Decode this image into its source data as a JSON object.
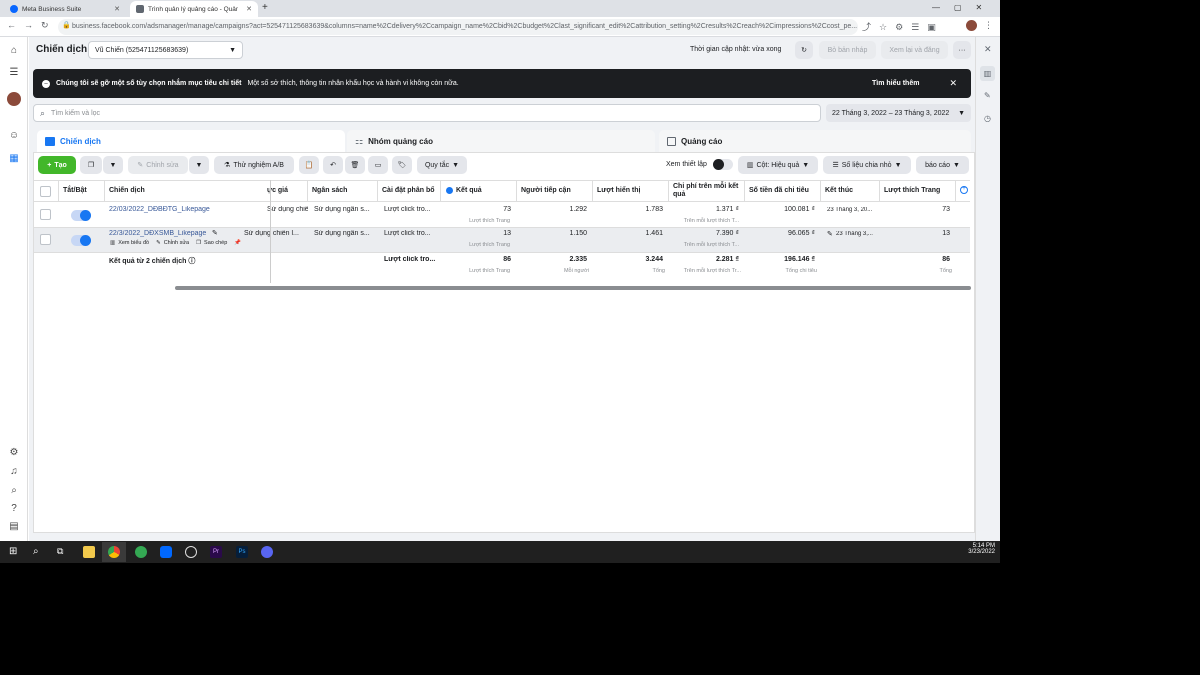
{
  "browser": {
    "tabs": [
      {
        "label": "Meta Business Suite"
      },
      {
        "label": "Trình quản lý quảng cáo - Quản"
      }
    ],
    "new_tab": "+",
    "url": "business.facebook.com/adsmanager/manage/campaigns?act=525471125683639&columns=name%2Cdelivery%2Ccampaign_name%2Cbid%2Cbudget%2Clast_significant_edit%2Cattribution_setting%2Cresults%2Creach%2Cimpressions%2Ccost_pe..."
  },
  "header": {
    "title": "Chiến dịch",
    "account": "Vũ Chiến (525471125683639)",
    "update_status": "Thời gian cập nhật: vừa xong",
    "discard_drafts": "Bỏ bản nháp",
    "review_publish": "Xem lại và đăng",
    "more": "···"
  },
  "banner": {
    "bold": "Chúng tôi sẽ gỡ một số tùy chọn nhắm mục tiêu chi tiết",
    "text": "Một số sở thích, thông tin nhân khẩu học và hành vi không còn nữa.",
    "link": "Tìm hiểu thêm"
  },
  "search": {
    "placeholder": "Tìm kiếm và lọc"
  },
  "date_range": "22 Tháng 3, 2022 – 23 Tháng 3, 2022",
  "level_tabs": [
    {
      "label": "Chiến dịch"
    },
    {
      "label": "Nhóm quảng cáo"
    },
    {
      "label": "Quảng cáo"
    }
  ],
  "toolbar": {
    "create": "Tạo",
    "edit": "Chỉnh sửa",
    "ab_test": "Thử nghiệm A/B",
    "rules": "Quy tắc",
    "view_setup": "Xem thiết lập",
    "columns": "Cột: Hiệu quả",
    "breakdown": "Số liệu chia nhỏ",
    "reports": "báo cáo"
  },
  "table": {
    "headers": {
      "onoff": "Tắt/Bật",
      "campaign": "Chiến dịch",
      "bid": "ực giá",
      "budget": "Ngân sách",
      "attribution": "Cài đặt phân bổ",
      "results": "Kết quả",
      "reach": "Người tiếp cận",
      "impressions": "Lượt hiển thị",
      "cost_per_result": "Chi phí trên mỗi kết quả",
      "amount_spent": "Số tiền đã chi tiêu",
      "ends": "Kết thúc",
      "page_likes": "Lượt thích Trang"
    },
    "rows": [
      {
        "name": "22/03/2022_DĐBĐTG_Likepage",
        "bid": "Sử dụng chiến l...",
        "budget": "Sử dụng ngân s...",
        "attribution": "Lượt click tro...",
        "results": "73",
        "results_sub": "Lượt thích Trang",
        "reach": "1.292",
        "impressions": "1.783",
        "cpr": "1.371 ₫",
        "cpr_sub": "Trên mỗi lượt thích T...",
        "spent": "100.081 ₫",
        "ends": "23 Tháng 3, 20...",
        "likes": "73"
      },
      {
        "name": "22/3/2022_DĐXSMB_Likepage",
        "bid": "Sử dụng chiến l...",
        "budget": "Sử dụng ngân s...",
        "attribution": "Lượt click tro...",
        "results": "13",
        "results_sub": "Lượt thích Trang",
        "reach": "1.150",
        "impressions": "1.461",
        "cpr": "7.390 ₫",
        "cpr_sub": "Trên mỗi lượt thích T...",
        "spent": "96.065 ₫",
        "ends": "23 Tháng 3,...",
        "likes": "13"
      }
    ],
    "row_actions": {
      "view_chart": "Xem biểu đồ",
      "edit": "Chỉnh sửa",
      "duplicate": "Sao chép"
    },
    "totals": {
      "label": "Kết quả từ 2 chiến dịch",
      "attribution": "Lượt click tro...",
      "results": "86",
      "results_sub": "Lượt thích Trang",
      "reach": "2.335",
      "reach_sub": "Mỗi người",
      "impressions": "3.244",
      "impressions_sub": "Tổng",
      "cpr": "2.281 ₫",
      "cpr_sub": "Trên mỗi lượt thích Tr...",
      "spent": "196.146 ₫",
      "spent_sub": "Tổng chi tiêu",
      "likes": "86",
      "likes_sub": "Tổng"
    }
  },
  "taskbar": {
    "time": "5:14 PM",
    "date": "3/23/2022"
  }
}
